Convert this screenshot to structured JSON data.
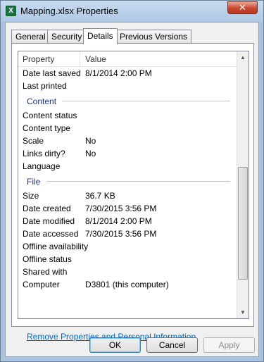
{
  "window": {
    "title": "Mapping.xlsx Properties",
    "app_icon": "excel-icon",
    "app_icon_glyph": "X",
    "close_glyph": "✕"
  },
  "tabs": [
    {
      "label": "General"
    },
    {
      "label": "Security"
    },
    {
      "label": "Details",
      "active": true
    },
    {
      "label": "Previous Versions"
    }
  ],
  "list": {
    "columns": {
      "property": "Property",
      "value": "Value"
    },
    "rows": [
      {
        "name": "Date last saved",
        "value": "8/1/2014 2:00 PM"
      },
      {
        "name": "Last printed",
        "value": ""
      }
    ],
    "group_content": {
      "title": "Content",
      "rows": [
        {
          "name": "Content status",
          "value": ""
        },
        {
          "name": "Content type",
          "value": ""
        },
        {
          "name": "Scale",
          "value": "No"
        },
        {
          "name": "Links dirty?",
          "value": "No"
        },
        {
          "name": "Language",
          "value": ""
        }
      ]
    },
    "group_file": {
      "title": "File",
      "rows": [
        {
          "name": "Size",
          "value": "36.7 KB"
        },
        {
          "name": "Date created",
          "value": "7/30/2015 3:56 PM"
        },
        {
          "name": "Date modified",
          "value": "8/1/2014 2:00 PM"
        },
        {
          "name": "Date accessed",
          "value": "7/30/2015 3:56 PM"
        },
        {
          "name": "Offline availability",
          "value": ""
        },
        {
          "name": "Offline status",
          "value": ""
        },
        {
          "name": "Shared with",
          "value": ""
        },
        {
          "name": "Computer",
          "value": "D3801 (this computer)"
        }
      ]
    }
  },
  "scrollbar": {
    "up_glyph": "▲",
    "down_glyph": "▼"
  },
  "remove_link": "Remove Properties and Personal Information",
  "buttons": {
    "ok": "OK",
    "cancel": "Cancel",
    "apply": "Apply"
  }
}
